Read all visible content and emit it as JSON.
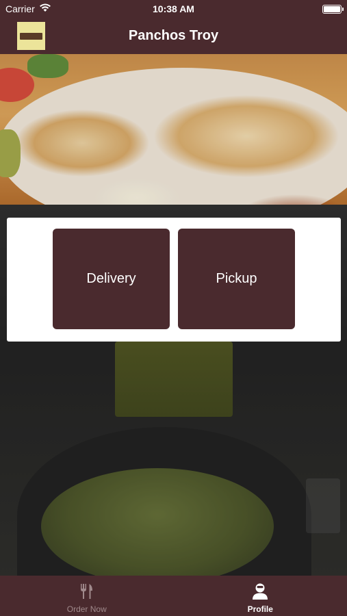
{
  "status": {
    "carrier": "Carrier",
    "time": "10:38 AM"
  },
  "nav": {
    "title": "Panchos Troy"
  },
  "order": {
    "delivery_label": "Delivery",
    "pickup_label": "Pickup"
  },
  "tabs": [
    {
      "label": "Order Now",
      "icon": "fork-knife-icon",
      "active": false
    },
    {
      "label": "Profile",
      "icon": "person-icon",
      "active": true
    }
  ],
  "colors": {
    "brand": "#4a2a2e",
    "panel": "#ffffff",
    "tab_inactive": "#a08a8c",
    "tab_active": "#ffffff"
  }
}
